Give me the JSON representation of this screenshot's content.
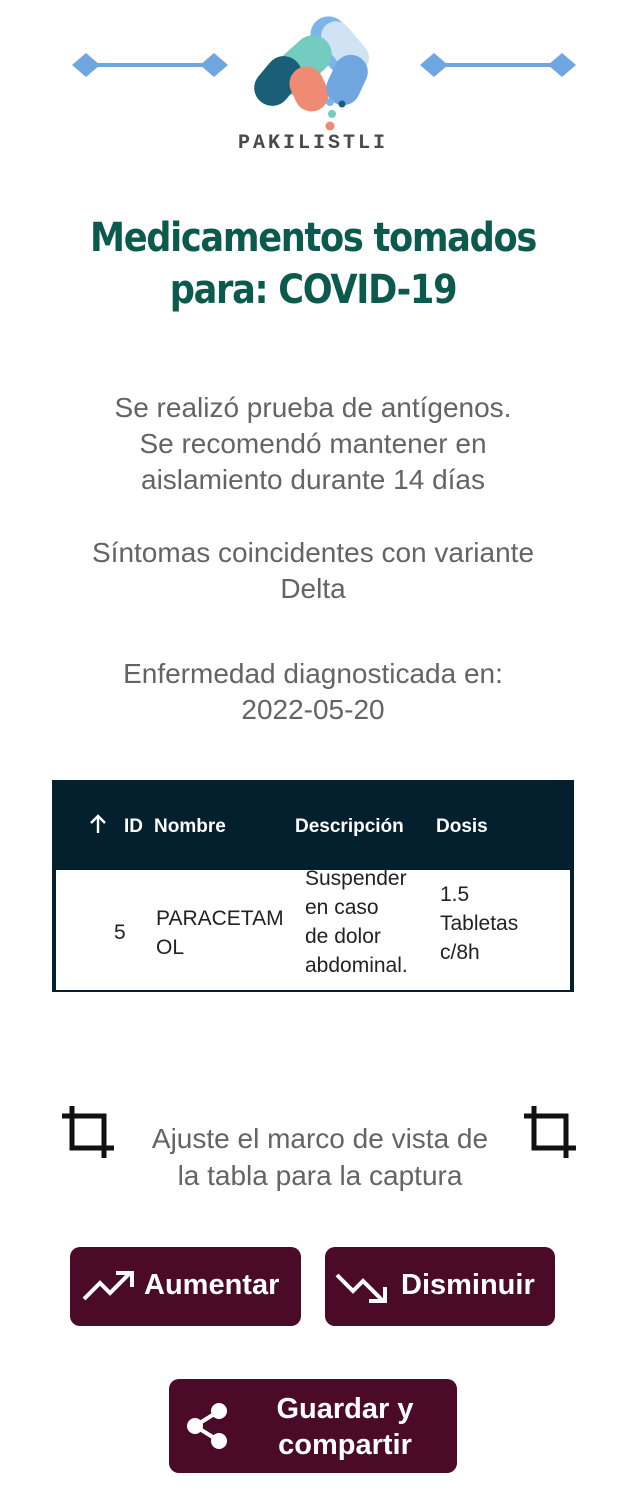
{
  "brand": {
    "name": "PAKILISTLI"
  },
  "header": {
    "title_line1": "Medicamentos tomados",
    "title_line2": "para: COVID-19"
  },
  "details": {
    "test_line1": "Se realizó prueba de antígenos.",
    "test_line2": "Se recomendó mantener en",
    "test_line3": "aislamiento durante 14 días",
    "symptoms_line1": "Síntomas coincidentes con variante",
    "symptoms_line2": "Delta",
    "diagnosed_label": "Enfermedad diagnosticada en:",
    "diagnosed_date": "2022-05-20"
  },
  "table": {
    "sort_icon": "arrow-up-icon",
    "headers": {
      "id": "ID",
      "name": "Nombre",
      "description": "Descripción",
      "dose": "Dosis"
    },
    "rows": [
      {
        "id": "5",
        "name_line1": "PARACETAM",
        "name_line2": "OL",
        "desc_line1": "Suspender",
        "desc_line2": "en caso",
        "desc_line3": "de dolor",
        "desc_line4": "abdominal.",
        "dose_line1": "1.5",
        "dose_line2": "Tabletas",
        "dose_line3": "c/8h"
      }
    ]
  },
  "adjust": {
    "line1": "Ajuste el marco de vista de",
    "line2": "la tabla para la captura",
    "icon": "crop-icon"
  },
  "buttons": {
    "increase_label": "Aumentar",
    "increase_icon": "trending-up-icon",
    "decrease_label": "Disminuir",
    "decrease_icon": "trending-down-icon",
    "save_line1": "Guardar y",
    "save_line2": "compartir",
    "save_icon": "share-icon"
  },
  "colors": {
    "title": "#0c5a4e",
    "table_header": "#041f2e",
    "button": "#4a0a28"
  }
}
